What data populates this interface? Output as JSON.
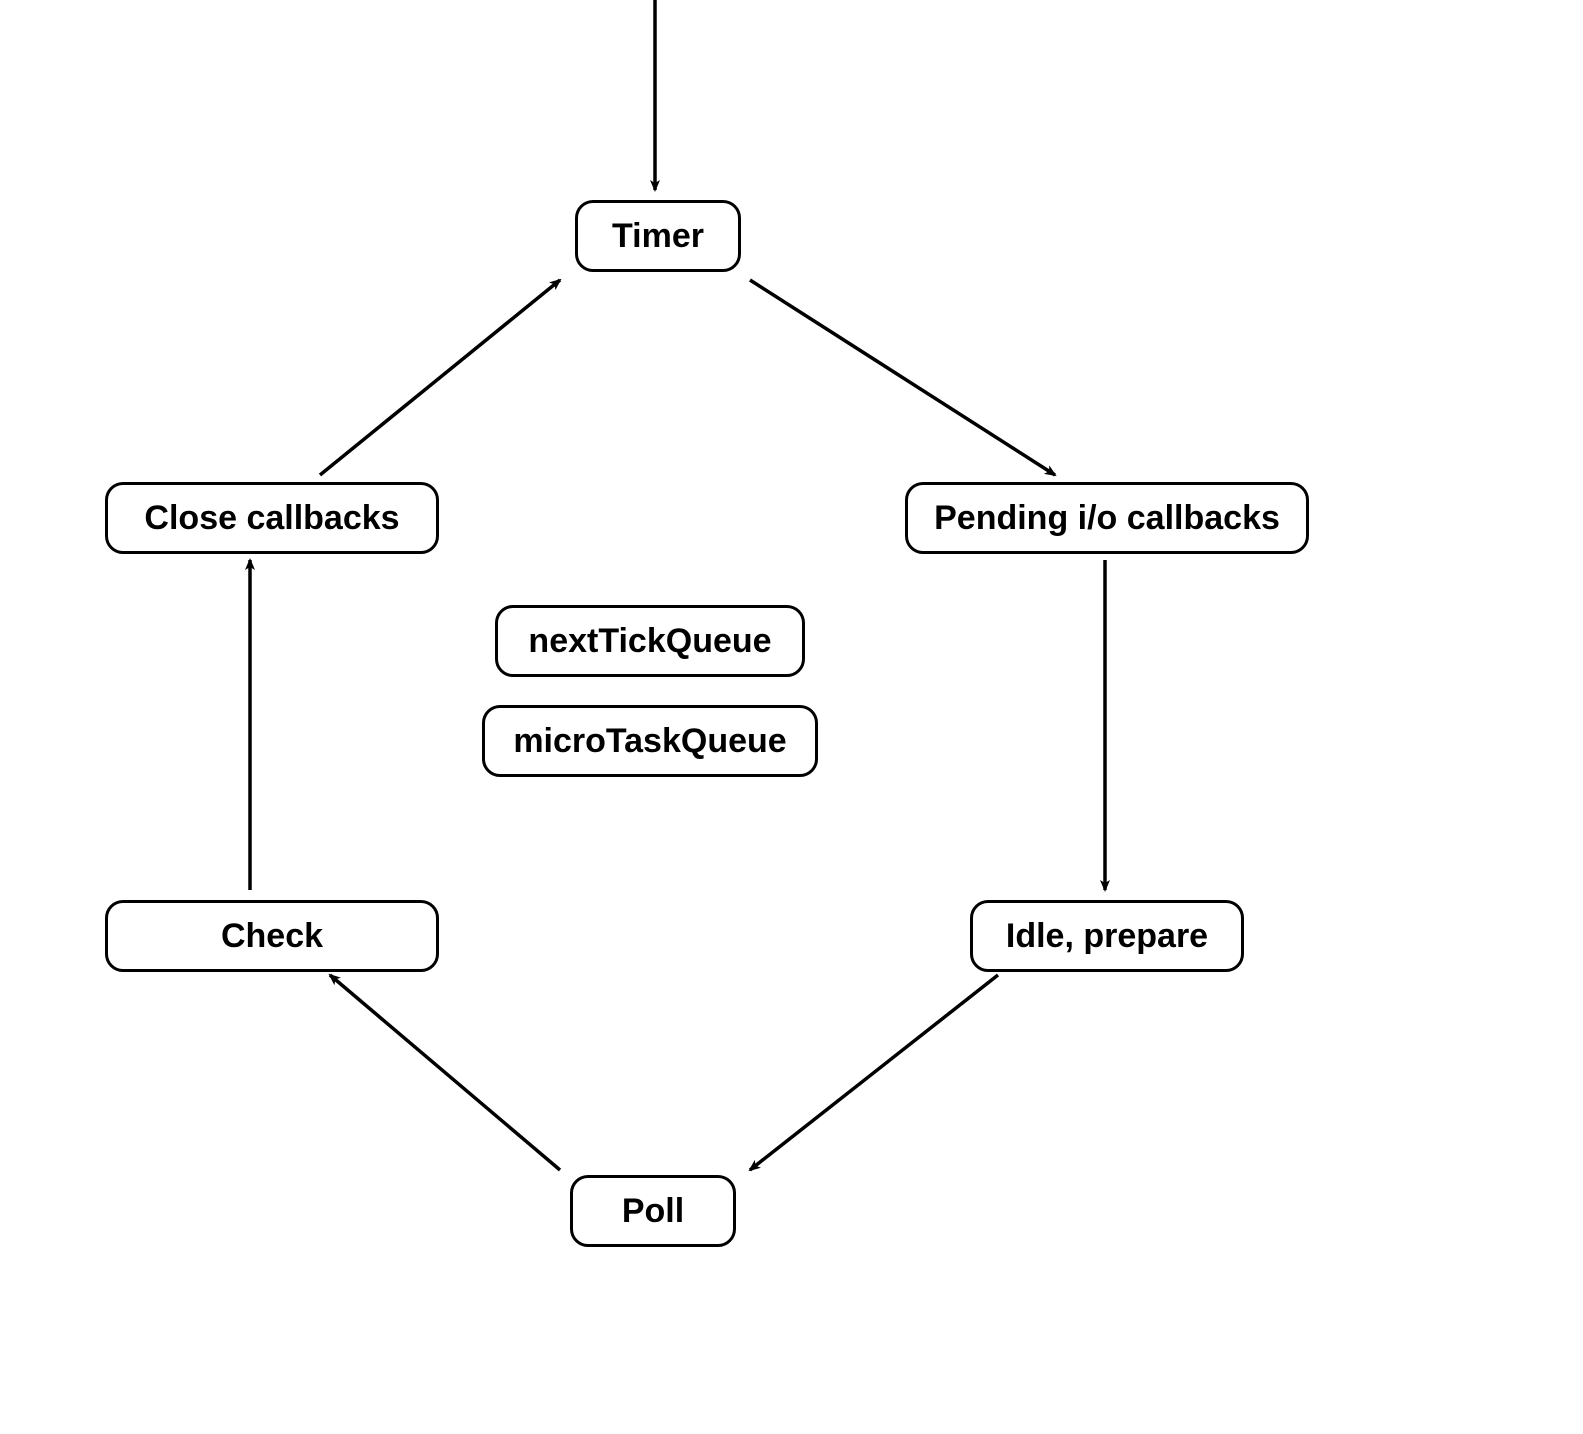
{
  "nodes": {
    "timer": {
      "label": "Timer"
    },
    "pending": {
      "label": "Pending i/o callbacks"
    },
    "idle": {
      "label": "Idle, prepare"
    },
    "poll": {
      "label": "Poll"
    },
    "check": {
      "label": "Check"
    },
    "close": {
      "label": "Close callbacks"
    },
    "nextTick": {
      "label": "nextTickQueue"
    },
    "microTask": {
      "label": "microTaskQueue"
    }
  }
}
